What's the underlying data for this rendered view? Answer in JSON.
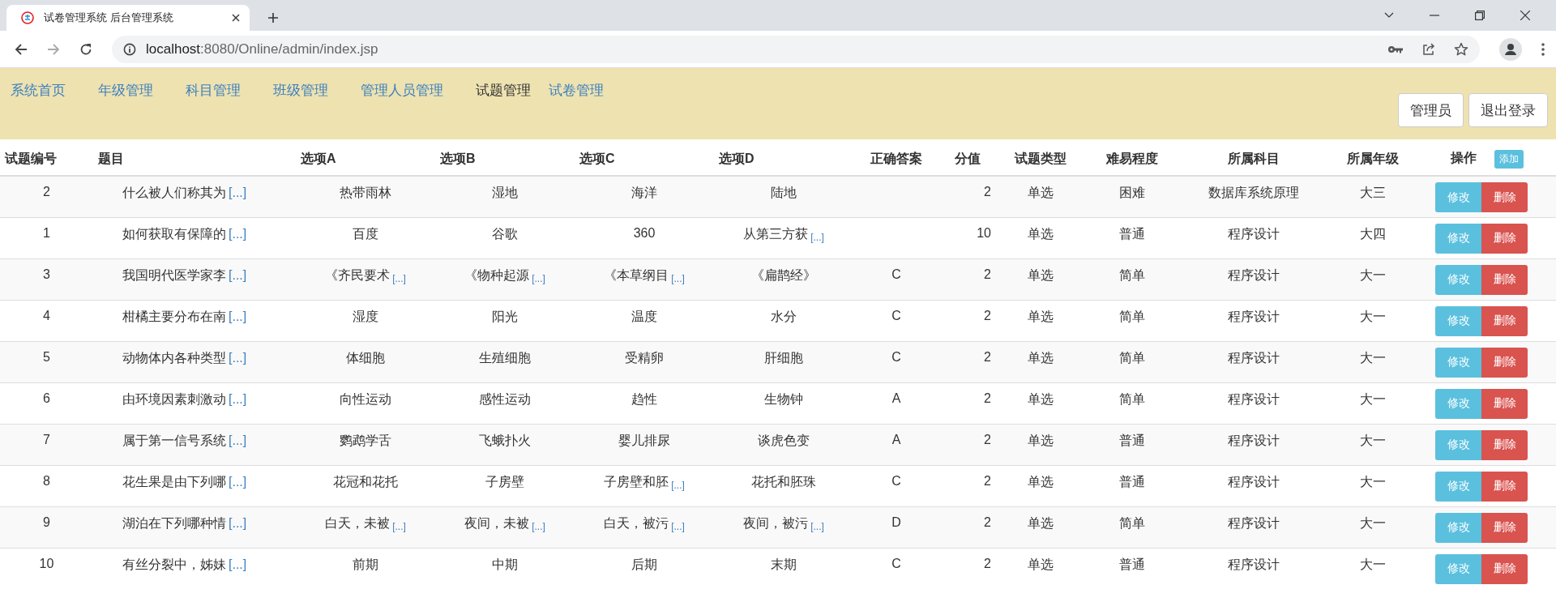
{
  "browser": {
    "tab_title": "试卷管理系统 后台管理系统",
    "url_host": "localhost",
    "url_path": ":8080/Online/admin/index.jsp"
  },
  "nav": [
    {
      "label": "系统首页",
      "selected": false
    },
    {
      "label": "年级管理",
      "selected": false
    },
    {
      "label": "科目管理",
      "selected": false
    },
    {
      "label": "班级管理",
      "selected": false
    },
    {
      "label": "管理人员管理",
      "selected": false
    },
    {
      "label": "试题管理",
      "selected": true
    },
    {
      "label": "试卷管理",
      "selected": false
    }
  ],
  "user_buttons": [
    "管理员",
    "退出登录"
  ],
  "table": {
    "columns": [
      "试题编号",
      "题目",
      "选项A",
      "选项B",
      "选项C",
      "选项D",
      "正确答案",
      "分值",
      "试题类型",
      "难易程度",
      "所属科目",
      "所属年级",
      "操作"
    ],
    "add_button": "添加",
    "rows": [
      {
        "id": "2",
        "question": {
          "text": "什么被人们称其为",
          "more": "[...]"
        },
        "options": [
          {
            "text": "热带雨林"
          },
          {
            "text": "湿地"
          },
          {
            "text": "海洋"
          },
          {
            "text": "陆地"
          }
        ],
        "answer": "",
        "score": "2",
        "type": "单选",
        "difficulty": "困难",
        "subject": "数据库系统原理",
        "grade": "大三",
        "actions": [
          "修改",
          "删除"
        ]
      },
      {
        "id": "1",
        "question": {
          "text": "如何获取有保障的",
          "more": "[...]"
        },
        "options": [
          {
            "text": "百度"
          },
          {
            "text": "谷歌"
          },
          {
            "text": "360"
          },
          {
            "text": "从第三方获",
            "more": "[...]"
          }
        ],
        "answer": "",
        "score": "10",
        "type": "单选",
        "difficulty": "普通",
        "subject": "程序设计",
        "grade": "大四",
        "actions": [
          "修改",
          "删除"
        ]
      },
      {
        "id": "3",
        "question": {
          "text": "我国明代医学家李",
          "more": "[...]"
        },
        "options": [
          {
            "text": "《齐民要术",
            "more": "[...]"
          },
          {
            "text": "《物种起源",
            "more": "[...]"
          },
          {
            "text": "《本草纲目",
            "more": "[...]"
          },
          {
            "text": "《扁鹊经》"
          }
        ],
        "answer": "C",
        "score": "2",
        "type": "单选",
        "difficulty": "简单",
        "subject": "程序设计",
        "grade": "大一",
        "actions": [
          "修改",
          "删除"
        ]
      },
      {
        "id": "4",
        "question": {
          "text": "柑橘主要分布在南",
          "more": "[...]"
        },
        "options": [
          {
            "text": "湿度"
          },
          {
            "text": "阳光"
          },
          {
            "text": "温度"
          },
          {
            "text": "水分"
          }
        ],
        "answer": "C",
        "score": "2",
        "type": "单选",
        "difficulty": "简单",
        "subject": "程序设计",
        "grade": "大一",
        "actions": [
          "修改",
          "删除"
        ]
      },
      {
        "id": "5",
        "question": {
          "text": "动物体内各种类型",
          "more": "[...]"
        },
        "options": [
          {
            "text": "体细胞"
          },
          {
            "text": "生殖细胞"
          },
          {
            "text": "受精卵"
          },
          {
            "text": "肝细胞"
          }
        ],
        "answer": "C",
        "score": "2",
        "type": "单选",
        "difficulty": "简单",
        "subject": "程序设计",
        "grade": "大一",
        "actions": [
          "修改",
          "删除"
        ]
      },
      {
        "id": "6",
        "question": {
          "text": "由环境因素刺激动",
          "more": "[...]"
        },
        "options": [
          {
            "text": "向性运动"
          },
          {
            "text": "感性运动"
          },
          {
            "text": "趋性"
          },
          {
            "text": "生物钟"
          }
        ],
        "answer": "A",
        "score": "2",
        "type": "单选",
        "difficulty": "简单",
        "subject": "程序设计",
        "grade": "大一",
        "actions": [
          "修改",
          "删除"
        ]
      },
      {
        "id": "7",
        "question": {
          "text": "属于第一信号系统",
          "more": "[...]"
        },
        "options": [
          {
            "text": "鹦鹉学舌"
          },
          {
            "text": "飞蛾扑火"
          },
          {
            "text": "婴儿排尿"
          },
          {
            "text": "谈虎色变"
          }
        ],
        "answer": "A",
        "score": "2",
        "type": "单选",
        "difficulty": "普通",
        "subject": "程序设计",
        "grade": "大一",
        "actions": [
          "修改",
          "删除"
        ]
      },
      {
        "id": "8",
        "question": {
          "text": "花生果是由下列哪",
          "more": "[...]"
        },
        "options": [
          {
            "text": "花冠和花托"
          },
          {
            "text": "子房壁"
          },
          {
            "text": "子房壁和胚",
            "more": "[...]"
          },
          {
            "text": "花托和胚珠"
          }
        ],
        "answer": "C",
        "score": "2",
        "type": "单选",
        "difficulty": "普通",
        "subject": "程序设计",
        "grade": "大一",
        "actions": [
          "修改",
          "删除"
        ]
      },
      {
        "id": "9",
        "question": {
          "text": "湖泊在下列哪种情",
          "more": "[...]"
        },
        "options": [
          {
            "text": "白天，未被",
            "more": "[...]"
          },
          {
            "text": "夜间，未被",
            "more": "[...]"
          },
          {
            "text": "白天，被污",
            "more": "[...]"
          },
          {
            "text": "夜间，被污",
            "more": "[...]"
          }
        ],
        "answer": "D",
        "score": "2",
        "type": "单选",
        "difficulty": "简单",
        "subject": "程序设计",
        "grade": "大一",
        "actions": [
          "修改",
          "删除"
        ]
      },
      {
        "id": "10",
        "question": {
          "text": "有丝分裂中，姊妹",
          "more": "[...]"
        },
        "options": [
          {
            "text": "前期"
          },
          {
            "text": "中期"
          },
          {
            "text": "后期"
          },
          {
            "text": "末期"
          }
        ],
        "answer": "C",
        "score": "2",
        "type": "单选",
        "difficulty": "普通",
        "subject": "程序设计",
        "grade": "大一",
        "actions": [
          "修改",
          "删除"
        ]
      }
    ]
  }
}
